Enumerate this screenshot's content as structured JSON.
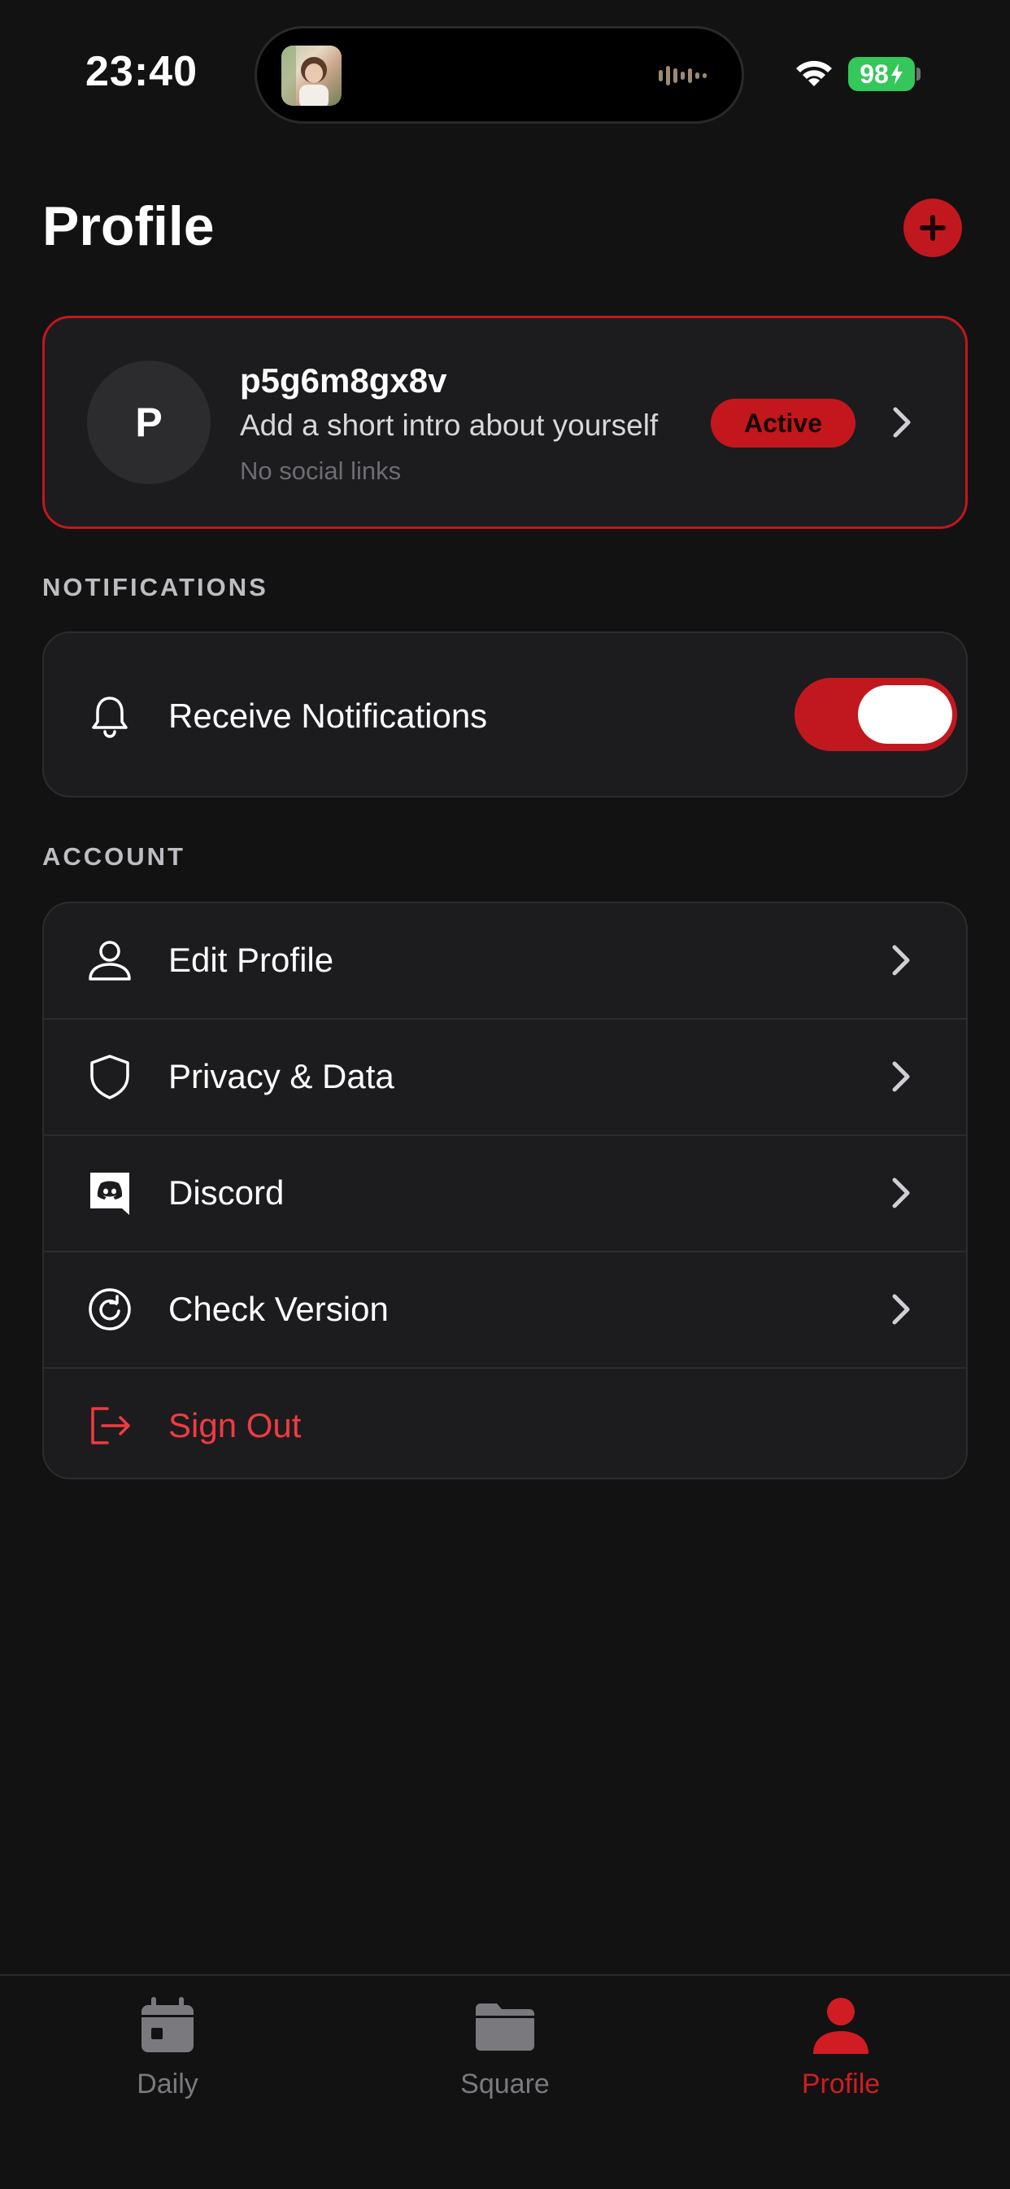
{
  "status_bar": {
    "time": "23:40",
    "battery": "98"
  },
  "header": {
    "title": "Profile"
  },
  "profile": {
    "initial": "P",
    "username": "p5g6m8gx8v",
    "intro": "Add a short intro about yourself",
    "social_links": "No social links",
    "status_badge": "Active"
  },
  "notifications": {
    "section_label": "NOTIFICATIONS",
    "items": [
      {
        "label": "Receive Notifications",
        "icon": "bell-icon",
        "enabled": true
      }
    ]
  },
  "account": {
    "section_label": "ACCOUNT",
    "items": [
      {
        "label": "Edit Profile",
        "icon": "person-icon"
      },
      {
        "label": "Privacy & Data",
        "icon": "shield-icon"
      },
      {
        "label": "Discord",
        "icon": "discord-icon"
      },
      {
        "label": "Check Version",
        "icon": "refresh-icon"
      },
      {
        "label": "Sign Out",
        "icon": "sign-out-icon"
      }
    ]
  },
  "tab_bar": {
    "tabs": [
      {
        "label": "Daily",
        "icon": "calendar-icon",
        "active": false
      },
      {
        "label": "Square",
        "icon": "folder-icon",
        "active": false
      },
      {
        "label": "Profile",
        "icon": "person-icon",
        "active": true
      }
    ]
  },
  "colors": {
    "accent": "#c4161d",
    "danger_text": "#ef3b42",
    "background": "#121212",
    "card": "#1c1c1e",
    "battery": "#34c759"
  }
}
